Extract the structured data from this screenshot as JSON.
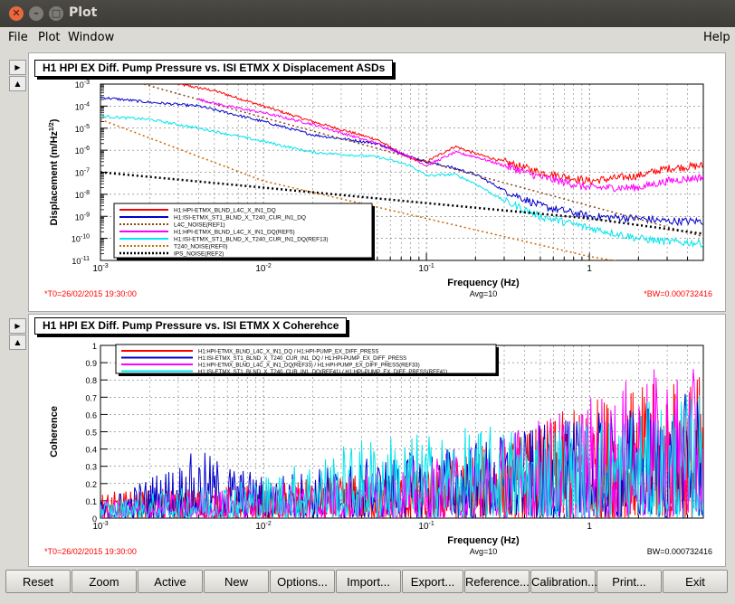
{
  "window": {
    "title": "Plot"
  },
  "menu": {
    "file": "File",
    "plot": "Plot",
    "window": "Window",
    "help": "Help"
  },
  "buttons": [
    "Reset",
    "Zoom",
    "Active",
    "New",
    "Options...",
    "Import...",
    "Export...",
    "Reference...",
    "Calibration...",
    "Print...",
    "Exit"
  ],
  "side_icons": {
    "expand": "right-triangle",
    "collapse": "up-triangle"
  },
  "colors": {
    "red": "#ff0000",
    "darkred": "#8b0000",
    "blue": "#0000cc",
    "magenta": "#ff00ff",
    "cyan": "#00e5ee",
    "brown": "#8b4513",
    "orange": "#cc6600",
    "black": "#000000"
  },
  "chart_data": [
    {
      "type": "line",
      "title": "H1 HPI EX Diff. Pump Pressure vs. ISI ETMX X Displacement ASDs",
      "xlabel": "Frequency (Hz)",
      "ylabel": "Displacement (m/Hz",
      "ylabel_sup": "1/2",
      "ylabel_close": ")",
      "xscale": "log",
      "yscale": "log",
      "xlim": [
        0.001,
        5
      ],
      "ylim": [
        1e-11,
        0.001
      ],
      "x_ticks": [
        "10",
        "10",
        "10",
        "1"
      ],
      "x_tick_exps": [
        "-3",
        "-2",
        "-1",
        ""
      ],
      "x_tick_vals": [
        0.001,
        0.01,
        0.1,
        1
      ],
      "y_ticks": [
        "10",
        "10",
        "10",
        "10",
        "10",
        "10",
        "10",
        "10",
        "10"
      ],
      "y_tick_exps": [
        "-3",
        "-4",
        "-5",
        "-6",
        "-7",
        "-8",
        "-9",
        "-10",
        "-11"
      ],
      "y_tick_vals": [
        0.001,
        0.0001,
        1e-05,
        1e-06,
        1e-07,
        1e-08,
        1e-09,
        1e-10,
        1e-11
      ],
      "grid": true,
      "legend_position": "bottom-left",
      "footer_left": "*T0=26/02/2015 19:30:00",
      "footer_center": "Avg=10",
      "footer_right": "*BW=0.000732416",
      "series": [
        {
          "name": "H1:HPI-ETMX_BLND_L4C_X_IN1_DQ",
          "color": "#ff0000",
          "style": "noisy",
          "x": [
            0.003,
            0.005,
            0.01,
            0.02,
            0.05,
            0.08,
            0.1,
            0.15,
            0.2,
            0.3,
            0.5,
            1,
            2,
            3,
            5
          ],
          "y": [
            0.001,
            0.0005,
            0.0001,
            2e-05,
            3e-06,
            4e-07,
            3e-07,
            1.5e-06,
            7e-07,
            3e-07,
            1e-07,
            4e-08,
            7e-08,
            1.5e-07,
            2e-07
          ]
        },
        {
          "name": "H1:ISI-ETMX_ST1_BLND_X_T240_CUR_IN1_DQ",
          "color": "#0000cc",
          "style": "noisy",
          "x": [
            0.001,
            0.002,
            0.004,
            0.006,
            0.01,
            0.02,
            0.05,
            0.08,
            0.1,
            0.15,
            0.2,
            0.3,
            0.5,
            1,
            2,
            3,
            5
          ],
          "y": [
            0.00025,
            0.00015,
            0.0001,
            5e-05,
            2e-05,
            5e-06,
            2e-06,
            5e-07,
            3e-07,
            1.5e-07,
            8e-08,
            1.5e-08,
            3e-09,
            1e-09,
            8e-10,
            6e-10,
            6e-10
          ]
        },
        {
          "name": "L4C_NOISE(REF1)",
          "color": "#8b4513",
          "style": "dotted",
          "x": [
            0.001,
            0.01,
            0.1,
            1,
            5
          ],
          "y": [
            0.0035,
            3e-05,
            3e-07,
            3e-09,
            1.2e-10
          ]
        },
        {
          "name": "H1:HPI-ETMX_BLND_L4C_X_IN1_DQ(REF5)",
          "color": "#ff00ff",
          "style": "noisy",
          "x": [
            0.004,
            0.006,
            0.01,
            0.02,
            0.05,
            0.08,
            0.1,
            0.15,
            0.2,
            0.3,
            0.5,
            1,
            2,
            3,
            5
          ],
          "y": [
            0.0002,
            0.0001,
            5e-05,
            1.5e-05,
            2e-06,
            5e-07,
            2e-07,
            8e-07,
            5e-07,
            2e-07,
            6e-08,
            2e-08,
            2e-08,
            4e-08,
            6e-08
          ]
        },
        {
          "name": "H1:ISI-ETMX_ST1_BLND_X_T240_CUR_IN1_DQ(REF13)",
          "color": "#00e5ee",
          "style": "noisy",
          "x": [
            0.001,
            0.002,
            0.004,
            0.01,
            0.02,
            0.05,
            0.08,
            0.1,
            0.15,
            0.2,
            0.3,
            0.5,
            1,
            2,
            3,
            5
          ],
          "y": [
            3.5e-05,
            2.5e-05,
            1e-05,
            2.5e-06,
            8e-07,
            5e-07,
            2e-07,
            7e-08,
            8e-08,
            3e-08,
            5e-09,
            1e-09,
            3e-10,
            1e-10,
            7e-11,
            6e-11
          ]
        },
        {
          "name": "T240_NOISE(REF0)",
          "color": "#cc6600",
          "style": "dotted",
          "x": [
            0.001,
            0.01,
            0.1,
            1,
            3
          ],
          "y": [
            2.5e-05,
            4e-08,
            8e-10,
            1.5e-11,
            4e-12
          ]
        },
        {
          "name": "IPS_NOISE(REF2)",
          "color": "#000000",
          "style": "dottedthick",
          "x": [
            0.001,
            0.01,
            0.1,
            1,
            5
          ],
          "y": [
            1e-07,
            2e-08,
            4e-09,
            8e-10,
            1.6e-10
          ]
        }
      ]
    },
    {
      "type": "line",
      "title": "H1 HPI EX Diff. Pump Pressure vs. ISI ETMX X Coherehce",
      "xlabel": "Frequency (Hz)",
      "ylabel": "Coherence",
      "xscale": "log",
      "yscale": "linear",
      "xlim": [
        0.001,
        5
      ],
      "ylim": [
        0,
        1
      ],
      "x_ticks": [
        "10",
        "10",
        "10",
        "1"
      ],
      "x_tick_exps": [
        "-3",
        "-2",
        "-1",
        ""
      ],
      "x_tick_vals": [
        0.001,
        0.01,
        0.1,
        1
      ],
      "y_ticks": [
        "0",
        "0.1",
        "0.2",
        "0.3",
        "0.4",
        "0.5",
        "0.6",
        "0.7",
        "0.8",
        "0.9",
        "1"
      ],
      "y_tick_vals": [
        0,
        0.1,
        0.2,
        0.3,
        0.4,
        0.5,
        0.6,
        0.7,
        0.8,
        0.9,
        1
      ],
      "grid": true,
      "legend_position": "top-left",
      "footer_left": "*T0=26/02/2015 19:30:00",
      "footer_center": "Avg=10",
      "footer_right": "BW=0.000732416",
      "series": [
        {
          "name": "H1:HPI-ETMX_BLND_L4C_X_IN1_DQ / H1:HPI-PUMP_EX_DIFF_PRESS",
          "color": "#ff0000",
          "envelope": [
            [
              0.001,
              0.15
            ],
            [
              0.01,
              0.2
            ],
            [
              0.1,
              0.3
            ],
            [
              0.5,
              0.55
            ],
            [
              1,
              0.7
            ],
            [
              3,
              0.8
            ],
            [
              5,
              0.85
            ]
          ]
        },
        {
          "name": "H1:ISI-ETMX_ST1_BLND_X_T240_CUR_IN1_DQ / H1:HPI-PUMP_EX_DIFF_PRESS",
          "color": "#0000cc",
          "envelope": [
            [
              0.001,
              0.1
            ],
            [
              0.004,
              0.4
            ],
            [
              0.01,
              0.25
            ],
            [
              0.1,
              0.4
            ],
            [
              1,
              0.6
            ],
            [
              5,
              0.75
            ]
          ]
        },
        {
          "name": "H1:HPI-ETMX_BLND_L4C_X_IN1_DQ(REF33) / H1:HPI-PUMP_EX_DIFF_PRESS(REF33)",
          "color": "#ff00ff",
          "envelope": [
            [
              0.001,
              0.1
            ],
            [
              0.01,
              0.2
            ],
            [
              0.1,
              0.35
            ],
            [
              1,
              0.7
            ],
            [
              3,
              0.9
            ],
            [
              5,
              0.85
            ]
          ]
        },
        {
          "name": "H1:ISI-ETMX_ST1_BLND_X_T240_CUR_IN1_DQ(REF41) / H1:HPI-PUMP_EX_DIFF_PRESS(REF41)",
          "color": "#00e5ee",
          "envelope": [
            [
              0.001,
              0.1
            ],
            [
              0.01,
              0.25
            ],
            [
              0.05,
              0.5
            ],
            [
              0.1,
              0.5
            ],
            [
              1,
              0.6
            ],
            [
              5,
              0.75
            ]
          ]
        }
      ]
    }
  ]
}
